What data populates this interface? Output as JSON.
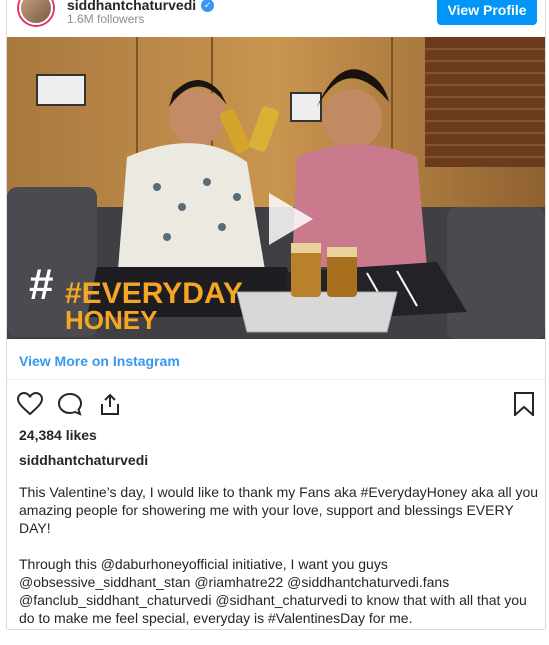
{
  "header": {
    "username": "siddhantchaturvedi",
    "followers": "1.6M followers",
    "view_profile_label": "View Profile"
  },
  "media": {
    "overlay_text_line1": "#EVERYDAY",
    "overlay_text_line2": "HONEY"
  },
  "links": {
    "view_more": "View More on Instagram"
  },
  "post": {
    "likes": "24,384 likes",
    "caption_user": "siddhantchaturvedi",
    "caption_paragraph_1": "This Valentine’s day, I would like to thank my Fans aka #EverydayHoney aka all you amazing people for showering me with your love, support and blessings EVERY DAY!",
    "caption_paragraph_2": "Through this @daburhoneyofficial initiative, I want you guys @obsessive_siddhant_stan @riamhatre22 @siddhantchaturvedi.fans @fanclub_siddhant_chaturvedi @sidhant_chaturvedi to know that with all that you do to make me feel special, everyday is #ValentinesDay for me."
  },
  "colors": {
    "accent": "#0095f6",
    "link": "#3897f0",
    "overlay_orange": "#f5a623"
  }
}
